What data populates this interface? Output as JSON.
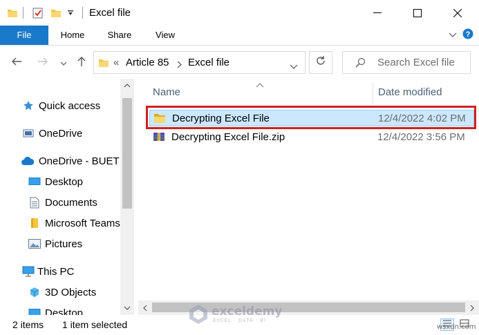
{
  "window": {
    "title": "Excel file",
    "controls": {
      "minimize_icon": "minimize-icon",
      "maximize_icon": "maximize-icon",
      "close_icon": "close-icon"
    }
  },
  "ribbon": {
    "tabs": [
      {
        "label": "File",
        "active": true
      },
      {
        "label": "Home"
      },
      {
        "label": "Share"
      },
      {
        "label": "View"
      }
    ]
  },
  "navigation": {
    "address": {
      "overflow": "«",
      "parts": [
        "Article 85",
        "Excel file"
      ]
    },
    "search_placeholder": "Search Excel file"
  },
  "sidebar": {
    "items": [
      {
        "label": "Quick access",
        "icon": "star-icon"
      },
      {
        "label": "OneDrive",
        "icon": "onedrive-icon"
      },
      {
        "label": "OneDrive - BUET",
        "icon": "cloud-icon"
      },
      {
        "label": "Desktop",
        "icon": "desktop-icon"
      },
      {
        "label": "Documents",
        "icon": "documents-icon"
      },
      {
        "label": "Microsoft Teams",
        "icon": "folder-icon"
      },
      {
        "label": "Pictures",
        "icon": "pictures-icon"
      },
      {
        "label": "This PC",
        "icon": "computer-icon"
      },
      {
        "label": "3D Objects",
        "icon": "cube-icon"
      },
      {
        "label": "Desktop",
        "icon": "desktop-icon"
      }
    ]
  },
  "content": {
    "columns": [
      "Name",
      "Date modified"
    ],
    "files": [
      {
        "name": "Decrypting Excel File",
        "date": "12/4/2022 4:02 PM",
        "type": "folder",
        "selected": true
      },
      {
        "name": "Decrypting Excel File.zip",
        "date": "12/4/2022 3:56 PM",
        "type": "zip",
        "selected": false
      }
    ]
  },
  "status": {
    "item_count": "2 items",
    "selection": "1 item selected"
  },
  "watermark": {
    "name": "exceldemy",
    "tagline": "EXCEL · DATA · BI",
    "site": "wsxdn.com"
  },
  "colors": {
    "accent": "#1979ca",
    "selection_bg": "#cce8ff",
    "highlight_border": "#d11f1f",
    "folder": "#f4c542"
  }
}
